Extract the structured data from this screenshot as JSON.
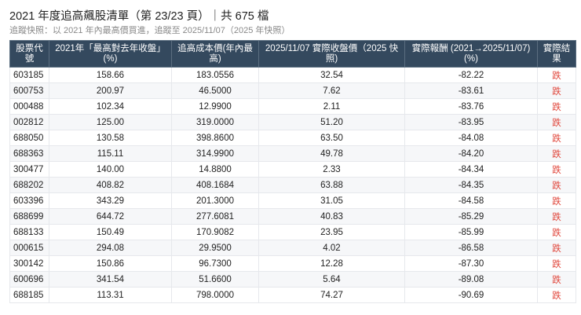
{
  "title": "2021 年度追高飆股清單（第 23/23 頁）｜共 675 檔",
  "subtitle": "追蹤快照：以 2021 年內最高價買進，追蹤至 2025/11/07（2025 年快照）",
  "colors": {
    "header_bg": "#34495e",
    "fall": "#e0453a"
  },
  "table": {
    "headers": [
      "股票代號",
      "2021年「最高對去年收盤」(%)",
      "追高成本價(年內最高)",
      "2025/11/07 實際收盤價（2025 快照)",
      "實際報酬 (2021→2025/11/07) (%)",
      "實際結果"
    ],
    "rows": [
      [
        "603185",
        "158.66",
        "183.0556",
        "32.54",
        "-82.22",
        "跌"
      ],
      [
        "600753",
        "200.97",
        "46.5000",
        "7.62",
        "-83.61",
        "跌"
      ],
      [
        "000488",
        "102.34",
        "12.9900",
        "2.11",
        "-83.76",
        "跌"
      ],
      [
        "002812",
        "125.00",
        "319.0000",
        "51.20",
        "-83.95",
        "跌"
      ],
      [
        "688050",
        "130.58",
        "398.8600",
        "63.50",
        "-84.08",
        "跌"
      ],
      [
        "688363",
        "115.11",
        "314.9900",
        "49.78",
        "-84.20",
        "跌"
      ],
      [
        "300477",
        "140.00",
        "14.8800",
        "2.33",
        "-84.34",
        "跌"
      ],
      [
        "688202",
        "408.82",
        "408.1684",
        "63.88",
        "-84.35",
        "跌"
      ],
      [
        "603396",
        "343.29",
        "201.3000",
        "31.05",
        "-84.58",
        "跌"
      ],
      [
        "688699",
        "644.72",
        "277.6081",
        "40.83",
        "-85.29",
        "跌"
      ],
      [
        "688133",
        "150.49",
        "170.9082",
        "23.95",
        "-85.99",
        "跌"
      ],
      [
        "000615",
        "294.08",
        "29.9500",
        "4.02",
        "-86.58",
        "跌"
      ],
      [
        "300142",
        "150.86",
        "96.7300",
        "12.28",
        "-87.30",
        "跌"
      ],
      [
        "600696",
        "341.54",
        "51.6600",
        "5.64",
        "-89.08",
        "跌"
      ],
      [
        "688185",
        "113.31",
        "798.0000",
        "74.27",
        "-90.69",
        "跌"
      ]
    ]
  }
}
